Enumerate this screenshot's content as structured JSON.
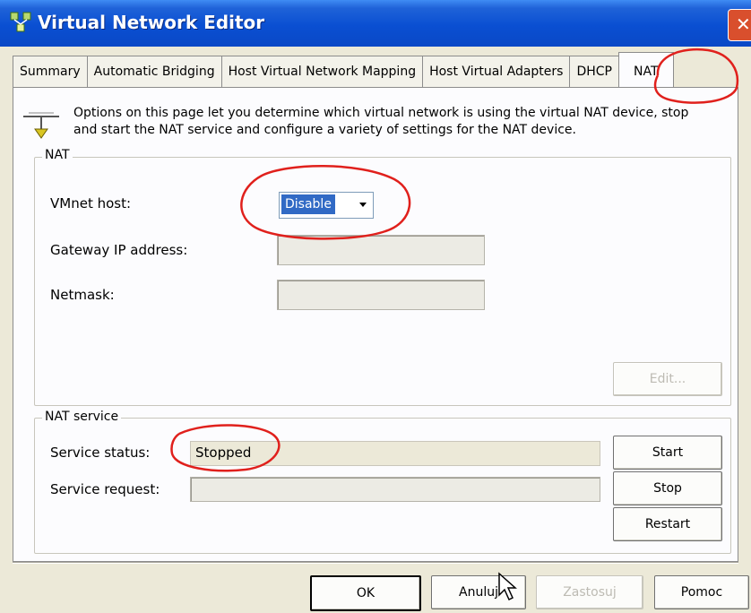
{
  "window": {
    "title": "Virtual Network Editor",
    "close_glyph": "✕"
  },
  "tabs": [
    {
      "label": "Summary"
    },
    {
      "label": "Automatic Bridging"
    },
    {
      "label": "Host Virtual Network Mapping"
    },
    {
      "label": "Host Virtual Adapters"
    },
    {
      "label": "DHCP"
    },
    {
      "label": "NAT"
    }
  ],
  "info": {
    "icon": "network-plug-icon",
    "line1": "Options on this page let you determine which virtual network is using the virtual NAT device, stop",
    "line2": "and start the NAT service and configure a variety of settings for the NAT device."
  },
  "nat": {
    "group_label": "NAT",
    "vmnet_host_label": "VMnet host:",
    "vmnet_host_value": "Disable",
    "gateway_label": "Gateway IP address:",
    "gateway_value": "",
    "netmask_label": "Netmask:",
    "netmask_value": "",
    "edit_button": "Edit..."
  },
  "nat_service": {
    "group_label": "NAT service",
    "status_label": "Service status:",
    "status_value": "Stopped",
    "request_label": "Service request:",
    "request_value": "",
    "start_button": "Start",
    "stop_button": "Stop",
    "restart_button": "Restart"
  },
  "footer": {
    "ok_button": "OK",
    "cancel_button": "Anuluj",
    "apply_button": "Zastosuj",
    "help_button": "Pomoc"
  },
  "annotation_color": "#e0201c"
}
